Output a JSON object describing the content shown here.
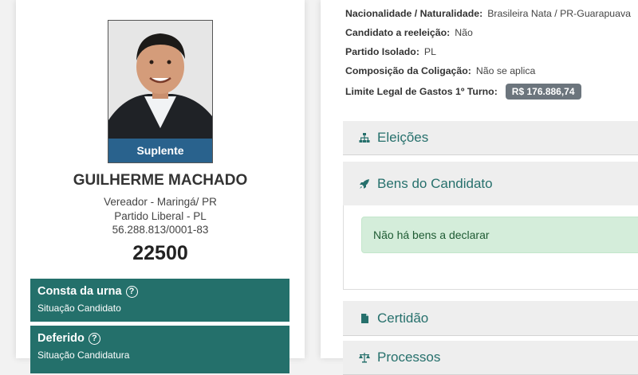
{
  "candidate": {
    "badge": "Suplente",
    "name": "GUILHERME MACHADO",
    "office": "Vereador - Maringá/ PR",
    "party": "Partido Liberal - PL",
    "cnpj": "56.288.813/0001-83",
    "number": "22500"
  },
  "status_boxes": [
    {
      "title": "Consta da urna",
      "subtitle": "Situação Candidato"
    },
    {
      "title": "Deferido",
      "subtitle": "Situação Candidatura"
    }
  ],
  "info": {
    "nationality_label": "Nacionalidade / Naturalidade:",
    "nationality_value": "Brasileira Nata / PR-Guarapuava",
    "reelection_label": "Candidato a reeleição:",
    "reelection_value": "Não",
    "party_label": "Partido Isolado:",
    "party_value": "PL",
    "coalition_label": "Composição da Coligação:",
    "coalition_value": "Não se aplica",
    "limit_label": "Limite Legal de Gastos 1º Turno:",
    "limit_value": "R$ 176.886,74"
  },
  "sections": {
    "eleicoes": "Eleições",
    "bens": "Bens do Candidato",
    "bens_empty": "Não há bens a declarar",
    "certidao": "Certidão",
    "processos": "Processos"
  },
  "colors": {
    "teal": "#24706b",
    "badge_blue": "#2c6da0",
    "alert_green": "#d4edda",
    "money_gray": "#6c757d"
  }
}
